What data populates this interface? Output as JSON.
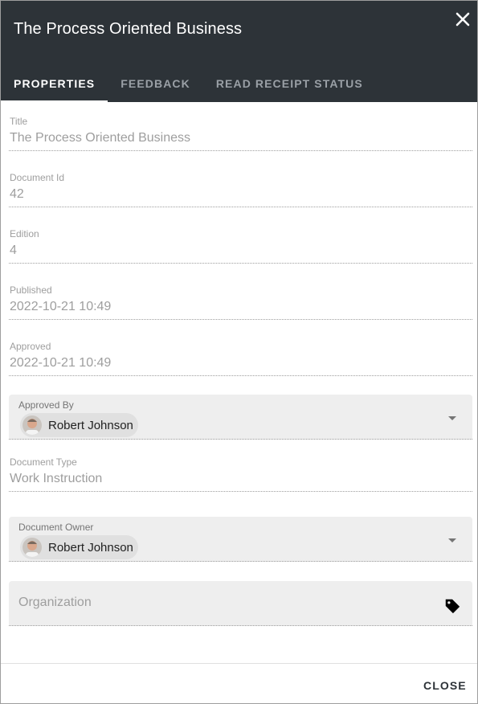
{
  "dialog": {
    "title": "The Process Oriented Business"
  },
  "tabs": [
    {
      "label": "PROPERTIES",
      "active": true
    },
    {
      "label": "FEEDBACK",
      "active": false
    },
    {
      "label": "READ RECEIPT STATUS",
      "active": false
    }
  ],
  "fields": {
    "title": {
      "label": "Title",
      "value": "The Process Oriented Business"
    },
    "document_id": {
      "label": "Document Id",
      "value": "42"
    },
    "edition": {
      "label": "Edition",
      "value": "4"
    },
    "published": {
      "label": "Published",
      "value": "2022-10-21 10:49"
    },
    "approved": {
      "label": "Approved",
      "value": "2022-10-21 10:49"
    },
    "approved_by": {
      "label": "Approved By",
      "value": "Robert Johnson"
    },
    "document_type": {
      "label": "Document Type",
      "value": "Work Instruction"
    },
    "document_owner": {
      "label": "Document Owner",
      "value": "Robert Johnson"
    },
    "organization": {
      "placeholder": "Organization"
    }
  },
  "footer": {
    "close_label": "CLOSE"
  },
  "colors": {
    "header_bg": "#2d3338",
    "field_bg": "#eeeeee",
    "muted_text": "#9e9e9e"
  }
}
